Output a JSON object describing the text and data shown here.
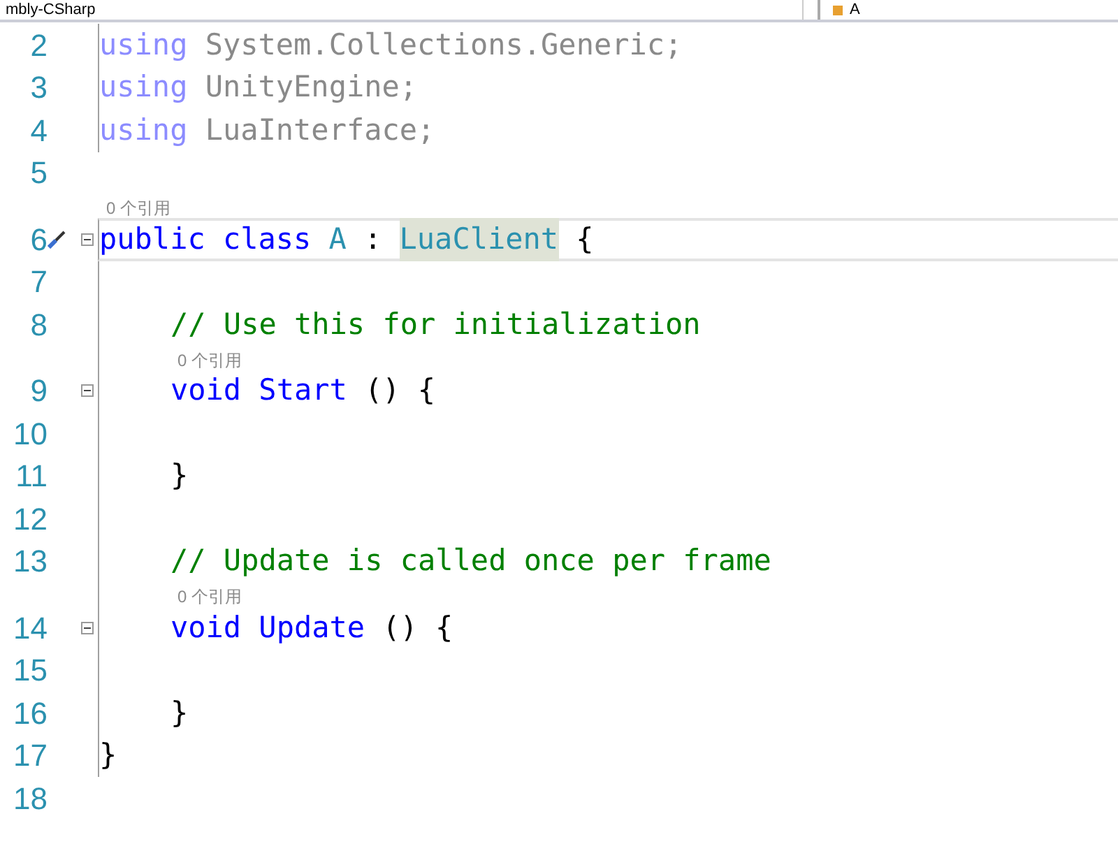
{
  "navigation_bar": {
    "project": "mbly-CSharp",
    "member": "A"
  },
  "lines": [
    {
      "number": "2",
      "outlined": true,
      "tokens": [
        {
          "kind": "keyword_faded",
          "text": "using"
        },
        {
          "kind": "text_faded",
          "text": "System.Collections.Generic;"
        }
      ]
    },
    {
      "number": "3",
      "outlined": true,
      "tokens": [
        {
          "kind": "keyword_faded",
          "text": "using"
        },
        {
          "kind": "text_faded",
          "text": "UnityEngine;"
        }
      ]
    },
    {
      "number": "4",
      "outlined": true,
      "tokens": [
        {
          "kind": "keyword_faded",
          "text": "using"
        },
        {
          "kind": "text_faded",
          "text": "LuaInterface;"
        }
      ]
    },
    {
      "number": "5",
      "outlined": false
    },
    {
      "number": "6",
      "outlined": true,
      "fold": true,
      "current": true,
      "gutter_icon": true,
      "lens": "0 个引用",
      "tokens": [
        {
          "kind": "keyword",
          "text": "public"
        },
        {
          "kind": "keyword",
          "text": "class"
        },
        {
          "kind": "type",
          "text": "A"
        },
        {
          "kind": "plain",
          "text": ":"
        },
        {
          "kind": "type",
          "text": "LuaClient",
          "highlight": true
        },
        {
          "kind": "plain",
          "text": "{"
        }
      ],
      "children": [
        {
          "number": "7",
          "outlined": true
        },
        {
          "number": "8",
          "outlined": true,
          "tokens": [
            {
              "kind": "comment",
              "text": "// Use this for initialization"
            }
          ]
        },
        {
          "number": "9",
          "outlined": true,
          "fold": true,
          "lens": "0 个引用",
          "tokens": [
            {
              "kind": "keyword",
              "text": "void"
            },
            {
              "kind": "method",
              "text": "Start"
            },
            {
              "kind": "plain",
              "text": "()"
            },
            {
              "kind": "plain",
              "text": "{"
            }
          ],
          "children": [
            {
              "number": "10",
              "outlined": true
            }
          ]
        },
        {
          "number": "11",
          "outlined": true,
          "tokens": [
            {
              "kind": "plain",
              "text": "}"
            }
          ]
        },
        {
          "number": "12",
          "outlined": true
        },
        {
          "number": "13",
          "outlined": true,
          "tokens": [
            {
              "kind": "comment",
              "text": "// Update is called once per frame"
            }
          ]
        },
        {
          "number": "14",
          "outlined": true,
          "fold": true,
          "lens": "0 个引用",
          "tokens": [
            {
              "kind": "keyword",
              "text": "void"
            },
            {
              "kind": "method",
              "text": "Update"
            },
            {
              "kind": "plain",
              "text": "()"
            },
            {
              "kind": "plain",
              "text": "{"
            }
          ],
          "children": [
            {
              "number": "15",
              "outlined": true
            }
          ]
        },
        {
          "number": "16",
          "outlined": true,
          "tokens": [
            {
              "kind": "plain",
              "text": "}"
            }
          ]
        }
      ]
    },
    {
      "number": "17",
      "outlined": true,
      "tokens": [
        {
          "kind": "plain",
          "text": "}"
        }
      ]
    },
    {
      "number": "18",
      "outlined": false
    }
  ]
}
